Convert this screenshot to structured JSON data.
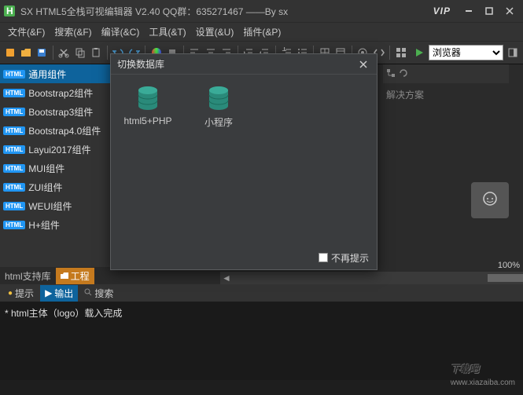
{
  "titlebar": {
    "title": "SX HTML5全栈可视编辑器  V2.40 QQ群：635271467  ——By sx",
    "vip": "VIP"
  },
  "menu": [
    "文件(&F)",
    "搜索(&F)",
    "编译(&C)",
    "工具(&T)",
    "设置(&U)",
    "插件(&P)"
  ],
  "toolbar": {
    "browser_label": "浏览器"
  },
  "sidebar": {
    "items": [
      {
        "label": "通用组件",
        "active": true
      },
      {
        "label": "Bootstrap2组件"
      },
      {
        "label": "Bootstrap3组件"
      },
      {
        "label": "Bootstrap4.0组件"
      },
      {
        "label": "Layui2017组件"
      },
      {
        "label": "MUI组件"
      },
      {
        "label": "ZUI组件"
      },
      {
        "label": "WEUI组件"
      },
      {
        "label": "H+组件"
      }
    ],
    "tabs": {
      "support": "html支持库",
      "project": "工程"
    }
  },
  "right_panel": {
    "label": "解决方案"
  },
  "zoom": "100%",
  "bottom_tabs": {
    "hint": "提示",
    "output": "输出",
    "search": "搜索"
  },
  "console": {
    "line1": "* html主体（logo）载入完成"
  },
  "dialog": {
    "title": "切换数据库",
    "items": [
      {
        "label": "html5+PHP"
      },
      {
        "label": "小程序"
      }
    ],
    "footer_label": "不再提示"
  },
  "watermark": {
    "main": "下载吧",
    "sub": "www.xiazaiba.com"
  }
}
